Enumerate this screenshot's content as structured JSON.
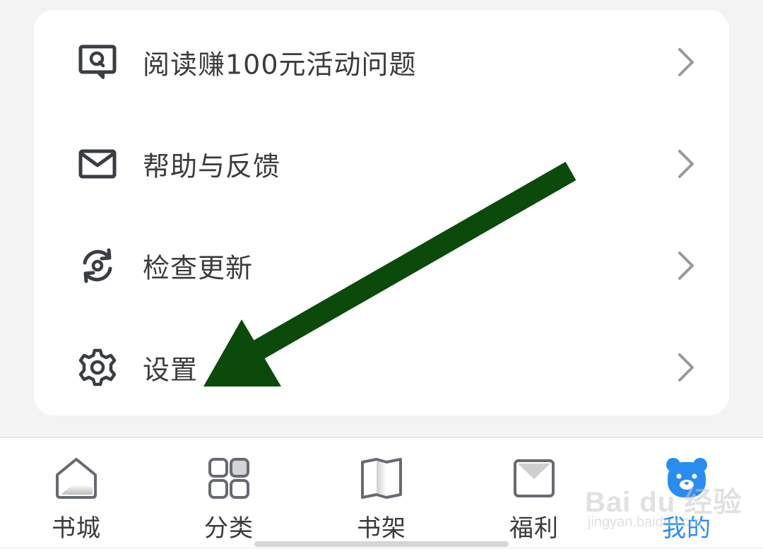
{
  "menu": {
    "items": [
      {
        "label": "阅读赚100元活动问题",
        "icon": "question-chat-icon"
      },
      {
        "label": "帮助与反馈",
        "icon": "mail-icon"
      },
      {
        "label": "检查更新",
        "icon": "refresh-icon"
      },
      {
        "label": "设置",
        "icon": "gear-icon"
      }
    ]
  },
  "tabbar": {
    "items": [
      {
        "label": "书城",
        "icon": "home-icon"
      },
      {
        "label": "分类",
        "icon": "category-grid-icon"
      },
      {
        "label": "书架",
        "icon": "bookshelf-icon"
      },
      {
        "label": "福利",
        "icon": "envelope-icon"
      },
      {
        "label": "我的",
        "icon": "bear-avatar-icon",
        "active": true
      }
    ]
  },
  "watermark": {
    "main": "Bai du 经验",
    "sub": "jingyan.baidu.com"
  },
  "colors": {
    "accent": "#2b8cf0",
    "annotation_arrow": "#0b4a0b",
    "text": "#3c3c3c",
    "chevron": "#999999"
  }
}
